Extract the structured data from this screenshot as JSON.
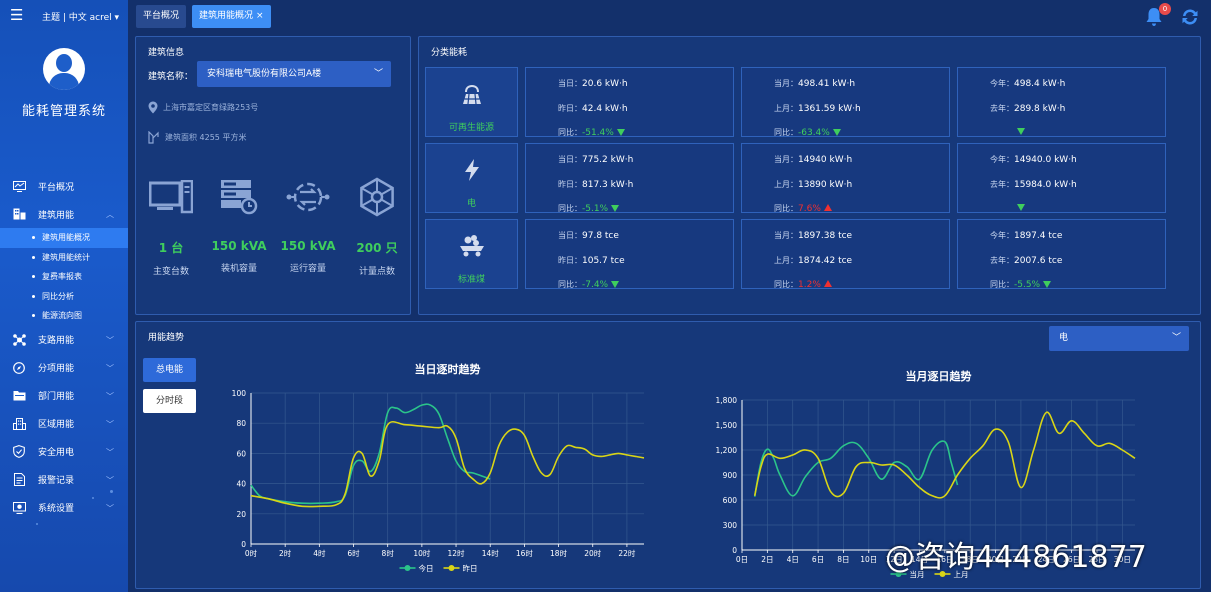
{
  "sidebar": {
    "topinfo": "主题 | 中文   acrel ▾",
    "system_title": "能耗管理系统",
    "items": [
      {
        "label": "平台概况",
        "icon": "monitor-icon"
      },
      {
        "label": "建筑用能",
        "icon": "building-icon",
        "expanded": true
      },
      {
        "label": "支路用能",
        "icon": "branch-icon"
      },
      {
        "label": "分项用能",
        "icon": "compass-icon"
      },
      {
        "label": "部门用能",
        "icon": "folder-icon"
      },
      {
        "label": "区域用能",
        "icon": "region-icon"
      },
      {
        "label": "安全用电",
        "icon": "shield-icon"
      },
      {
        "label": "报警记录",
        "icon": "document-icon"
      },
      {
        "label": "系统设置",
        "icon": "settings-icon"
      }
    ],
    "subitems": [
      "建筑用能概况",
      "建筑用能统计",
      "复费率报表",
      "同比分析",
      "能源流向图"
    ],
    "active_subitem": 0
  },
  "header": {
    "tabs": [
      {
        "label": "平台概况"
      },
      {
        "label": "建筑用能概况"
      }
    ],
    "close_glyph": "×",
    "notifications": "0"
  },
  "building": {
    "title": "建筑信息",
    "name_label": "建筑名称：",
    "name_value": "安科瑞电气股份有限公司A楼",
    "address": "上海市嘉定区育绿路253号",
    "area": "建筑面积 4255 平方米",
    "stats": [
      {
        "value": "1 台",
        "label": "主变台数",
        "icon": "host-icon"
      },
      {
        "value": "150 kVA",
        "label": "装机容量",
        "icon": "server-icon"
      },
      {
        "value": "150 kVA",
        "label": "运行容量",
        "icon": "network-icon"
      },
      {
        "value": "200 只",
        "label": "计量点数",
        "icon": "hexagon-network-icon"
      }
    ]
  },
  "category": {
    "title": "分类能耗",
    "rows": [
      {
        "name": "可再生能源",
        "icon": "solar-icon",
        "day": {
          "l1": "当日：",
          "v1": "20.6 kW·h",
          "l2": "昨日：",
          "v2": "42.4 kW·h",
          "yoy_label": "同比：",
          "yoy": "-51.4%",
          "dir": "down"
        },
        "month": {
          "l1": "当月：",
          "v1": "498.41 kW·h",
          "l2": "上月：",
          "v2": "1361.59 kW·h",
          "yoy_label": "同比：",
          "yoy": "-63.4%",
          "dir": "down"
        },
        "year": {
          "l1": "今年：",
          "v1": "498.4 kW·h",
          "l2": "去年：",
          "v2": "289.8 kW·h",
          "yoy_label": "",
          "yoy": "",
          "dir": "down"
        }
      },
      {
        "name": "电",
        "icon": "lightning-icon",
        "day": {
          "l1": "当日：",
          "v1": "775.2 kW·h",
          "l2": "昨日：",
          "v2": "817.3 kW·h",
          "yoy_label": "同比：",
          "yoy": "-5.1%",
          "dir": "down"
        },
        "month": {
          "l1": "当月：",
          "v1": "14940 kW·h",
          "l2": "上月：",
          "v2": "13890 kW·h",
          "yoy_label": "同比：",
          "yoy": "7.6%",
          "dir": "up"
        },
        "year": {
          "l1": "今年：",
          "v1": "14940.0 kW·h",
          "l2": "去年：",
          "v2": "15984.0 kW·h",
          "yoy_label": "",
          "yoy": "",
          "dir": "down"
        }
      },
      {
        "name": "标准煤",
        "icon": "coal-icon",
        "day": {
          "l1": "当日：",
          "v1": "97.8 tce",
          "l2": "昨日：",
          "v2": "105.7 tce",
          "yoy_label": "同比：",
          "yoy": "-7.4%",
          "dir": "down"
        },
        "month": {
          "l1": "当月：",
          "v1": "1897.38 tce",
          "l2": "上月：",
          "v2": "1874.42 tce",
          "yoy_label": "同比：",
          "yoy": "1.2%",
          "dir": "up"
        },
        "year": {
          "l1": "今年：",
          "v1": "1897.4 tce",
          "l2": "去年：",
          "v2": "2007.6 tce",
          "yoy_label": "同比：",
          "yoy": "-5.5%",
          "dir": "down"
        }
      }
    ]
  },
  "trend": {
    "title": "用能趋势",
    "select_value": "电",
    "btn_total": "总电能",
    "btn_period": "分时段"
  },
  "colors": {
    "series1": "#2bc48a",
    "series2": "#d9d516",
    "accent": "#3fce5d",
    "up": "#f03030"
  },
  "chart_data": [
    {
      "type": "line",
      "title": "当日逐时趋势",
      "ylim": [
        0,
        100
      ],
      "yticks": [
        0,
        20,
        40,
        60,
        80,
        100
      ],
      "xlim": [
        0,
        23
      ],
      "xticks": [
        "0时",
        "2时",
        "4时",
        "6时",
        "8时",
        "10时",
        "12时",
        "14时",
        "16时",
        "18时",
        "20时",
        "22时"
      ],
      "xtick_values": [
        0,
        2,
        4,
        6,
        8,
        10,
        12,
        14,
        16,
        18,
        20,
        22
      ],
      "grid": true,
      "legend": "bottom",
      "series": [
        {
          "name": "今日",
          "x": [
            0,
            0.5,
            1,
            2,
            3,
            4,
            5,
            5.5,
            6,
            6.5,
            7,
            7.5,
            8,
            8.5,
            9,
            9.5,
            10,
            10.5,
            11,
            11.5,
            12,
            12.5,
            13,
            14
          ],
          "values": [
            39,
            32,
            30,
            28,
            27,
            27,
            28,
            32,
            52,
            55,
            48,
            60,
            87,
            90,
            87,
            89,
            92,
            92,
            86,
            70,
            55,
            48,
            47,
            43
          ]
        },
        {
          "name": "昨日",
          "x": [
            0,
            1,
            2,
            3,
            4,
            5,
            5.5,
            6,
            6.5,
            7,
            7.5,
            8,
            9,
            10,
            11,
            11.5,
            12,
            12.5,
            13,
            13.5,
            14,
            14.5,
            15,
            15.5,
            16,
            16.5,
            17,
            17.5,
            18,
            18.5,
            19,
            19.5,
            20,
            20.5,
            21,
            21.5,
            22,
            22.5,
            23
          ],
          "values": [
            32,
            30,
            27,
            25,
            25,
            26,
            33,
            57,
            60,
            45,
            55,
            79,
            79,
            78,
            77,
            78,
            70,
            50,
            43,
            40,
            47,
            65,
            74,
            76,
            72,
            58,
            47,
            46,
            58,
            65,
            64,
            63,
            59,
            58,
            59,
            60,
            59,
            58,
            57
          ]
        }
      ]
    },
    {
      "type": "line",
      "title": "当月逐日趋势",
      "ylim": [
        0,
        1800
      ],
      "yticks": [
        "0",
        "300",
        "600",
        "900",
        "1,200",
        "1,500",
        "1,800"
      ],
      "ytick_values": [
        0,
        300,
        600,
        900,
        1200,
        1500,
        1800
      ],
      "xlim": [
        0,
        31
      ],
      "xticks": [
        "0日",
        "2日",
        "4日",
        "6日",
        "8日",
        "10日",
        "12日",
        "14日",
        "16日",
        "18日",
        "20日",
        "22日",
        "24日",
        "26日",
        "28日",
        "30日"
      ],
      "xtick_values": [
        0,
        2,
        4,
        6,
        8,
        10,
        12,
        14,
        16,
        18,
        20,
        22,
        24,
        26,
        28,
        30
      ],
      "grid": true,
      "legend": "bottom",
      "series": [
        {
          "name": "当月",
          "x": [
            1,
            1.5,
            2,
            2.5,
            3,
            4,
            5,
            6,
            7,
            8,
            9,
            10,
            11,
            12,
            13,
            14,
            15,
            16,
            16.5,
            17
          ],
          "values": [
            640,
            1050,
            1210,
            1100,
            900,
            650,
            880,
            1050,
            1100,
            1250,
            1280,
            1100,
            850,
            1050,
            1000,
            850,
            1200,
            1300,
            1050,
            780
          ]
        },
        {
          "name": "上月",
          "x": [
            1,
            1.5,
            2,
            3,
            4,
            5,
            6,
            7,
            8,
            9,
            10,
            11,
            12,
            13,
            14,
            15,
            16,
            17,
            18,
            19,
            20,
            21,
            22,
            23,
            24,
            25,
            26,
            27,
            28,
            29,
            30,
            31
          ],
          "values": [
            650,
            1000,
            1150,
            1100,
            1140,
            1200,
            1100,
            700,
            680,
            1000,
            1050,
            1020,
            1020,
            900,
            750,
            650,
            650,
            900,
            1100,
            1250,
            1450,
            1300,
            750,
            1200,
            1650,
            1400,
            1550,
            1400,
            1250,
            1280,
            1200,
            1100
          ]
        }
      ]
    }
  ],
  "watermark": "@咨询444861877"
}
